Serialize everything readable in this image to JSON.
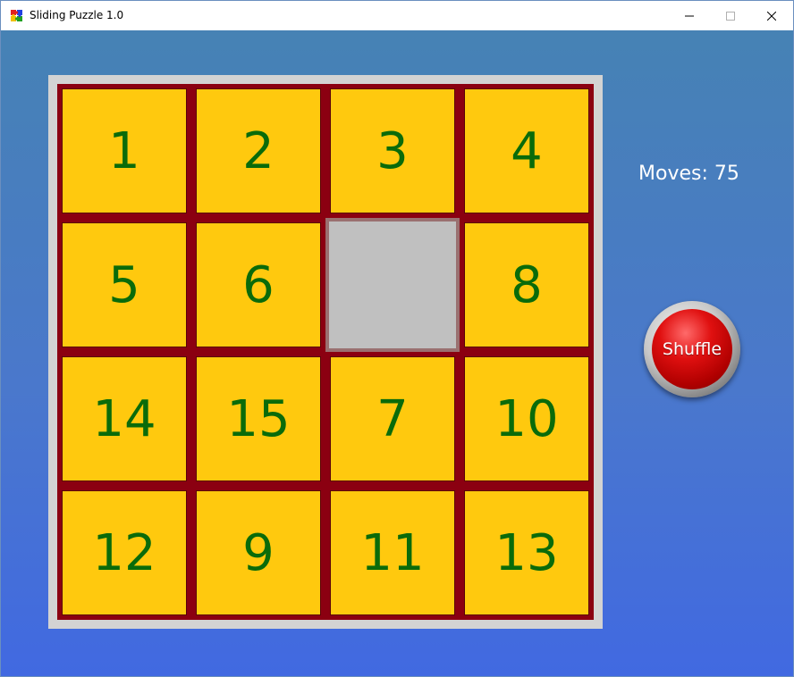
{
  "window": {
    "title": "Sliding Puzzle 1.0",
    "app_icon": "puzzle-icon",
    "controls": {
      "minimize_icon": "minimize-icon",
      "maximize_icon": "maximize-icon",
      "close_icon": "close-icon"
    }
  },
  "game": {
    "grid_size": 4,
    "tiles": [
      "1",
      "2",
      "3",
      "4",
      "5",
      "6",
      "",
      "8",
      "14",
      "15",
      "7",
      "10",
      "12",
      "9",
      "11",
      "13"
    ],
    "moves_label": "Moves: 75",
    "shuffle_label": "Shuffle"
  },
  "colors": {
    "tile_fill": "#ffc90e",
    "tile_border": "#8b0011",
    "tile_text": "#0a6b0a",
    "empty_fill": "#c0c0c0",
    "board_frame": "#d3d3d3",
    "background_top": "#4682b4",
    "background_bottom": "#4169e1",
    "shuffle_button": "#d00000"
  }
}
